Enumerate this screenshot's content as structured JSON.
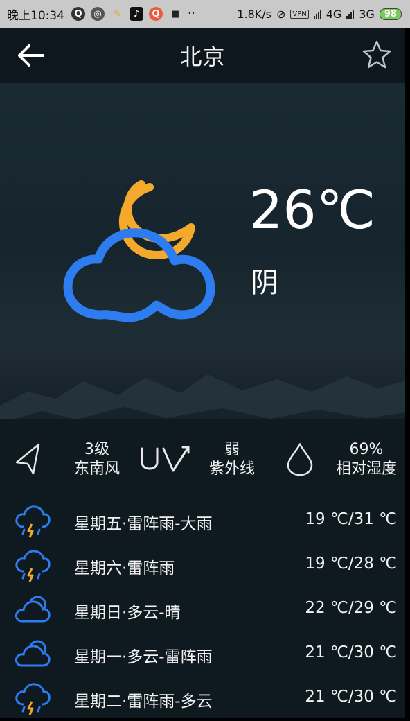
{
  "status_bar": {
    "time": "晚上10:34",
    "net_speed": "1.8K/s",
    "vpn": "VPN",
    "network_1": "4G",
    "network_2": "3G",
    "battery": "98",
    "colors": {
      "battery": "#7dc95e"
    }
  },
  "header": {
    "city": "北京",
    "back_icon": "arrow-left-icon",
    "favorite_icon": "star-outline-icon"
  },
  "current": {
    "temperature": "26℃",
    "condition": "阴",
    "icon": "cloud-moon-icon",
    "colors": {
      "cloud": "#2d7cf0",
      "moon": "#f4a82c"
    }
  },
  "details": {
    "wind": {
      "icon": "navigation-arrow-icon",
      "level": "3级",
      "direction": "东南风"
    },
    "uv": {
      "icon": "uv-icon",
      "level": "弱",
      "label": "紫外线"
    },
    "humidity": {
      "icon": "water-drop-icon",
      "value": "69%",
      "label": "相对湿度"
    }
  },
  "forecast": [
    {
      "day": "星期五·雷阵雨-大雨",
      "temp": "19 ℃/31 ℃",
      "icon": "thunderstorm-icon"
    },
    {
      "day": "星期六·雷阵雨",
      "temp": "19 ℃/28 ℃",
      "icon": "thunderstorm-icon"
    },
    {
      "day": "星期日·多云-晴",
      "temp": "22 ℃/29 ℃",
      "icon": "cloudy-icon"
    },
    {
      "day": "星期一·多云-雷阵雨",
      "temp": "21 ℃/30 ℃",
      "icon": "cloudy-icon"
    },
    {
      "day": "星期二·雷阵雨-多云",
      "temp": "21 ℃/30 ℃",
      "icon": "thunderstorm-icon"
    }
  ]
}
